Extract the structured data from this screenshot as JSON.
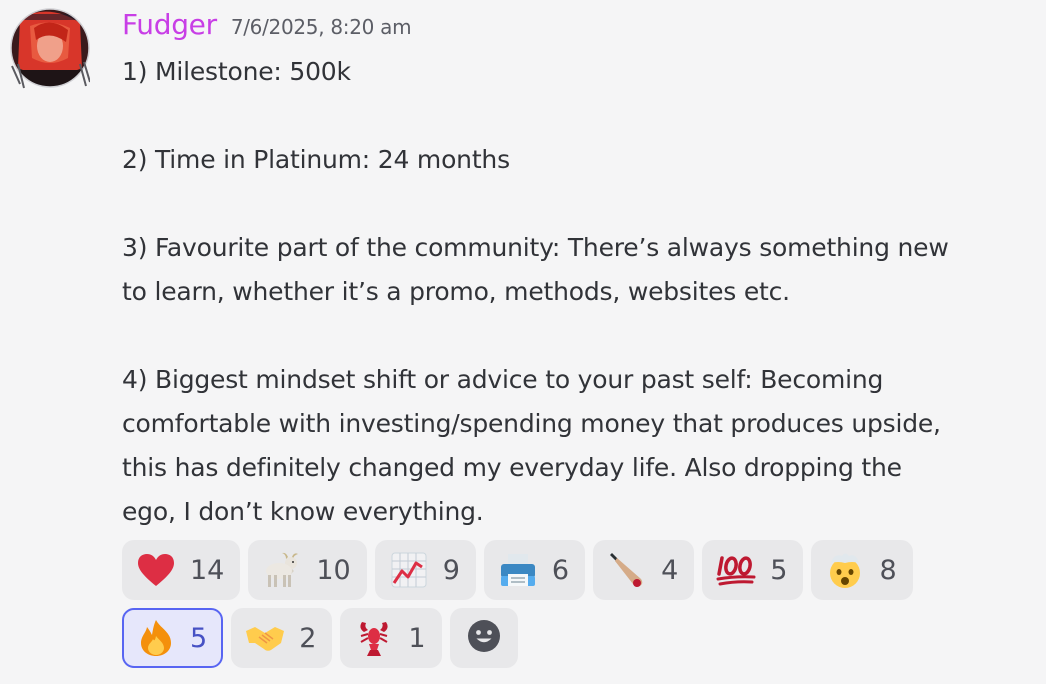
{
  "message": {
    "author": "Fudger",
    "timestamp": "7/6/2025, 8:20 am",
    "lines": {
      "l1": "1) Milestone: 500k",
      "l2": "2) Time in Platinum: 24 months",
      "l3a": "3) Favourite part of the community: There’s always something new",
      "l3b": "to learn, whether it’s a promo, methods, websites etc.",
      "l4a": "4) Biggest mindset shift or advice to your past self: Becoming",
      "l4b": "comfortable with investing/spending money that produces upside,",
      "l4c": "this has definitely changed my everyday life. Also dropping the",
      "l4d": "ego, I don’t know everything."
    }
  },
  "reactions": [
    {
      "icon": "red-heart-icon",
      "count": "14"
    },
    {
      "icon": "goat-icon",
      "count": "10"
    },
    {
      "icon": "chart-increasing-icon",
      "count": "9"
    },
    {
      "icon": "printer-icon",
      "count": "6"
    },
    {
      "icon": "cricket-bat-icon",
      "count": "4"
    },
    {
      "icon": "hundred-points-icon",
      "count": "5"
    },
    {
      "icon": "exploding-head-icon",
      "count": "8"
    },
    {
      "icon": "fire-icon",
      "count": "5",
      "active": true
    },
    {
      "icon": "handshake-icon",
      "count": "2"
    },
    {
      "icon": "lobster-icon",
      "count": "1"
    }
  ],
  "colors": {
    "username": "#c83ee6",
    "active_reaction_border": "#5865f2",
    "background": "#f5f5f6"
  },
  "add_reaction_icon": "add-reaction-smiley-icon"
}
